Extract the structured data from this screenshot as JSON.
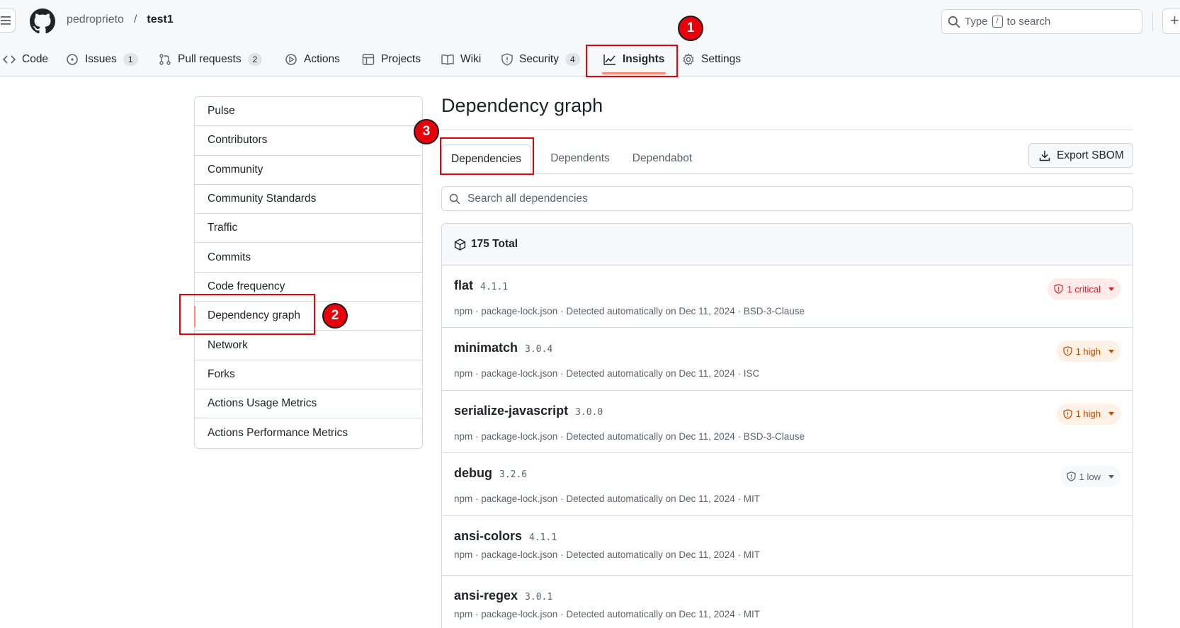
{
  "header": {
    "owner": "pedroprieto",
    "separator": "/",
    "repo": "test1",
    "search_prefix": "Type",
    "search_key": "/",
    "search_suffix": "to search",
    "plus": "+"
  },
  "nav": [
    {
      "label": "Code"
    },
    {
      "label": "Issues",
      "count": "1"
    },
    {
      "label": "Pull requests",
      "count": "2"
    },
    {
      "label": "Actions"
    },
    {
      "label": "Projects"
    },
    {
      "label": "Wiki"
    },
    {
      "label": "Security",
      "count": "4"
    },
    {
      "label": "Insights",
      "active": true
    },
    {
      "label": "Settings"
    }
  ],
  "sidebar": {
    "items": [
      {
        "label": "Pulse"
      },
      {
        "label": "Contributors"
      },
      {
        "label": "Community"
      },
      {
        "label": "Community Standards"
      },
      {
        "label": "Traffic"
      },
      {
        "label": "Commits"
      },
      {
        "label": "Code frequency"
      },
      {
        "label": "Dependency graph",
        "selected": true
      },
      {
        "label": "Network"
      },
      {
        "label": "Forks"
      },
      {
        "label": "Actions Usage Metrics"
      },
      {
        "label": "Actions Performance Metrics"
      }
    ]
  },
  "main": {
    "title": "Dependency graph",
    "tabs": [
      {
        "label": "Dependencies",
        "active": true
      },
      {
        "label": "Dependents"
      },
      {
        "label": "Dependabot"
      }
    ],
    "export_label": "Export SBOM",
    "search_placeholder": "Search all dependencies",
    "total_label": "175 Total",
    "dependencies": [
      {
        "name": "flat",
        "version": "4.1.1",
        "meta": "npm · package-lock.json · Detected automatically on Dec 11, 2024 · BSD-3-Clause",
        "severity": "1 critical",
        "level": "critical"
      },
      {
        "name": "minimatch",
        "version": "3.0.4",
        "meta": "npm · package-lock.json · Detected automatically on Dec 11, 2024 · ISC",
        "severity": "1 high",
        "level": "high"
      },
      {
        "name": "serialize-javascript",
        "version": "3.0.0",
        "meta": "npm · package-lock.json · Detected automatically on Dec 11, 2024 · BSD-3-Clause",
        "severity": "1 high",
        "level": "high"
      },
      {
        "name": "debug",
        "version": "3.2.6",
        "meta": "npm · package-lock.json · Detected automatically on Dec 11, 2024 · MIT",
        "severity": "1 low",
        "level": "low"
      },
      {
        "name": "ansi-colors",
        "version": "4.1.1",
        "meta": "npm · package-lock.json · Detected automatically on Dec 11, 2024 · MIT"
      },
      {
        "name": "ansi-regex",
        "version": "3.0.1",
        "meta": "npm · package-lock.json · Detected automatically on Dec 11, 2024 · MIT"
      }
    ]
  },
  "annotations": {
    "step1": "1",
    "step2": "2",
    "step3": "3"
  },
  "colors": {
    "highlight": "#e8000b",
    "critical": "#d1242f",
    "high": "#bc4c00",
    "accent_underline": "#fd8c73"
  }
}
